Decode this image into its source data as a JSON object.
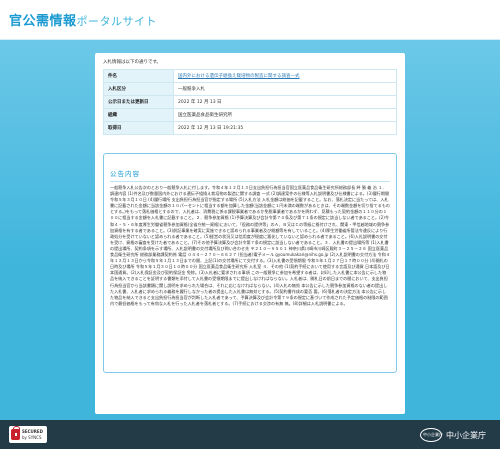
{
  "header": {
    "title_main": "官公需情報",
    "title_sub": "ポータルサイト"
  },
  "page": {
    "intro": "入札情報は以下の通りです。"
  },
  "info": {
    "rows": [
      {
        "label": "件名",
        "value": "国内外における遺伝子組換え栽培物の製造に関する調査一式",
        "is_link": true
      },
      {
        "label": "入札区分",
        "value": "一般競争入札",
        "is_link": false
      },
      {
        "label": "公示日または更新日",
        "value": "2022 年 12 月 13 日",
        "is_link": false
      },
      {
        "label": "組織",
        "value": "国立医薬品食品衛生研究所",
        "is_link": false
      },
      {
        "label": "取得日",
        "value": "2022 年 12 月 13 日 19:21:35",
        "is_link": false
      }
    ]
  },
  "content": {
    "heading": "公告内容",
    "text": "一般競争入札公告次のとおり一般競争入札に付します。令和４年１２月１３日支出負担行為担当官国立医薬品食品衛生研究所総務部長 畔 勝 義 治 １．調達内容 (1)件名及び数量国内外における遺伝子組換え栽培物の製造に関する調査 一式 (2)調達案件の仕様等入札説明書及び仕様書による。(3)履行期間 令和５年３月１０日 (4)履行場所 支出負担行為担当官が指定する場所 (5)入札方法 入札金額は総価を記載すること。なお、落札決定に当たっては、入札書に記載された金額に当該金額の１０パーセントに相当する額を加算した金額(当該金額に１円未満の端数があるときは、その端数金額を切り捨てるものとする。)をもって落札価格とするので、入札者は、消費税に係る課税事業者であるか免税事業者であるかを問わず、見積もった契約金額の１１０分の１００に相当する金額を入札書に記載すること。２．競争参加資格 (1)予算決算及び会計令第７０条及び第７１条の規定に該当しない者であること。(2)令和４・５・６年度厚生労働省競争参加資格(全省庁統一資格)において、「役務の提供等」のＡ、Ｂ又はＣの等級に格付けされ、関東・甲信越地域の競争参加資格を有する者であること。(3)前記事業を確実に実施できると認められる事業者及び総額等を有していること。(4)厚生労働省所管法令違反により行政処分を受けていないと認められる者であること。(5)経営の状況又は信用度が極度に悪化していないと認められる者であること。(6)入札説明書の交付を受け、資格の審査を受けた者であること。(7)その他予算決算及び会計令第７条の規定に該当しない者であること。３．入札書の提出場所等 (1)入札書の提出場所、契約条項を示す場所、入札説明書の交付場所及び問い合わせ先 〒２１０－９５０１ 神奈川県川崎市川崎区殿町３－２５－２６ 国立医薬品食品衛生研究所 総務部業務課契約係 電話 ０４４－２７０－６６２７ (担当者)電子メール gyoumukakari@nihs.go.jp (2)入札説明書の交付方法 令和４年１２月１３日から令和５年１月１３日までの間、上記(1)の交付場所にて交付する。(3)入札書の受領期限 令和５年１月２７日１７時００分 (4)開札の日時及び場所 令和５年１月３０日１０時００分 国立医薬品食品衛生研究所 入札室 ４．その他 (1)契約手続において使用する言語及び通貨 日本語及び日本国通貨。(2)入札保証金及び契約保証金 免除。(3)入札者に要求される事項 この一般競争に参加を希望する者は、封印した入札書に本公告に示した物品を納入できることを証明する書類を添付して入札書の受領期限までに提出しなければならない。入札者は、開札日の前日までの間において、支出負担行為担当官から当該書類に関し説明を求められた場合は、それに応じなければならない。(4)入札の無効 本公告に示した競争参加資格のない者の提出した入札書、入札者に求められる義務を履行しなかった者の提出した入札書は無効とする。(5)契約書作成の要否 要。(6)落札者の決定方法 本公告に示した物品を納入できると支出負担行為担当官が判断した入札者であって、予算決算及び会計令第７９条の規定に基づいて作成された予定価格の制限の範囲内で最低価格をもって有効な入札を行った入札者を落札者とする。(7)手続における交渉の有無 無。(8)詳細は入札説明書による。"
  },
  "footer": {
    "secured_line1": "SECURED",
    "secured_line2": "by SYNCS",
    "agency_logo_text": "中小企業庁",
    "agency_name": "中小企業庁"
  }
}
